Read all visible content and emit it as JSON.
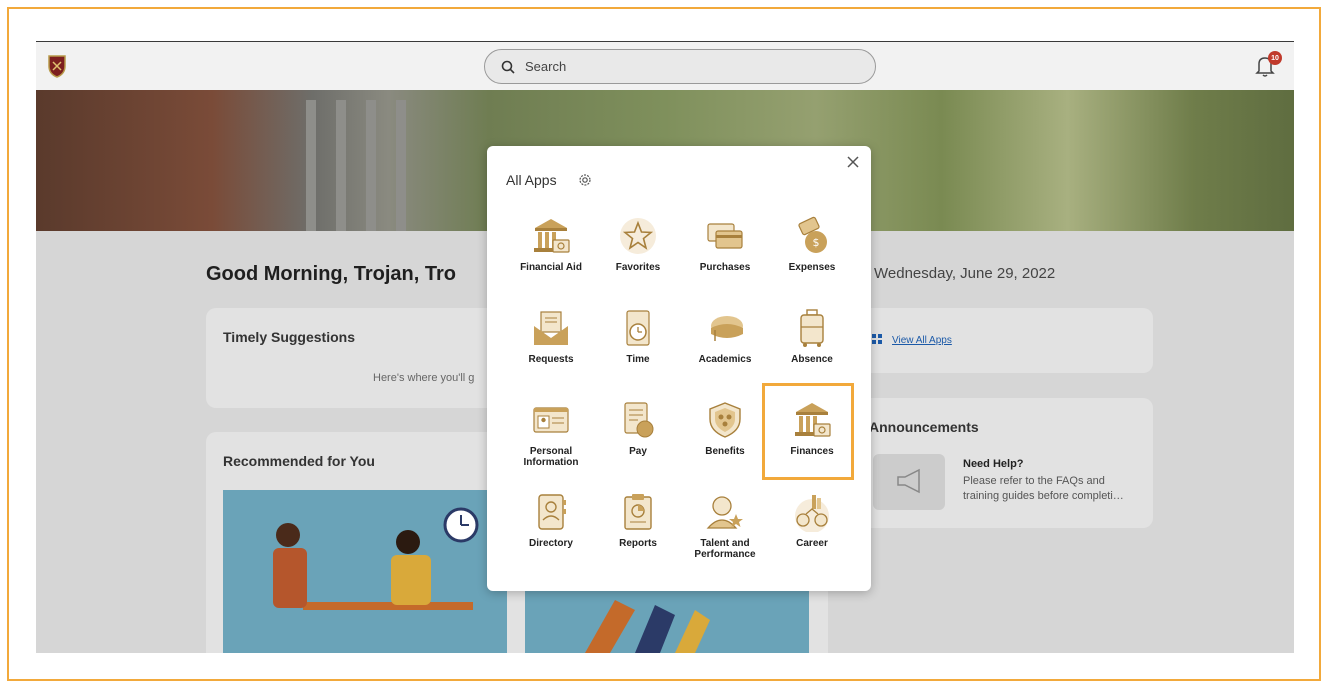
{
  "header": {
    "search_placeholder": "Search",
    "notification_count": "10"
  },
  "home": {
    "greeting": "Good Morning, Trojan, Tro",
    "date": "Wednesday, June 29, 2022",
    "timely_suggestions_title": "Timely Suggestions",
    "timely_suggestions_text": "Here's where you'll g",
    "recommended_title": "Recommended for You",
    "view_all_apps": "View All Apps",
    "announcements_title": "Announcements",
    "need_help_title": "Need Help?",
    "need_help_text": "Please refer to the FAQs and training guides before completi…"
  },
  "modal": {
    "title": "All Apps",
    "apps": [
      {
        "label": "Financial Aid",
        "icon": "bank-money-icon"
      },
      {
        "label": "Favorites",
        "icon": "star-icon"
      },
      {
        "label": "Purchases",
        "icon": "credit-card-icon"
      },
      {
        "label": "Expenses",
        "icon": "money-bag-icon"
      },
      {
        "label": "Requests",
        "icon": "envelope-icon"
      },
      {
        "label": "Time",
        "icon": "clock-icon"
      },
      {
        "label": "Academics",
        "icon": "graduation-cap-icon"
      },
      {
        "label": "Absence",
        "icon": "luggage-icon"
      },
      {
        "label": "Personal Information",
        "icon": "id-card-icon"
      },
      {
        "label": "Pay",
        "icon": "payslip-icon"
      },
      {
        "label": "Benefits",
        "icon": "shield-icon"
      },
      {
        "label": "Finances",
        "icon": "bank-money-icon"
      },
      {
        "label": "Directory",
        "icon": "address-book-icon"
      },
      {
        "label": "Reports",
        "icon": "clipboard-chart-icon"
      },
      {
        "label": "Talent and Performance",
        "icon": "person-star-icon"
      },
      {
        "label": "Career",
        "icon": "career-ladder-icon"
      }
    ]
  },
  "colors": {
    "accent": "#c9a15a",
    "highlight": "#f2a93b",
    "link": "#1c5aa8"
  }
}
